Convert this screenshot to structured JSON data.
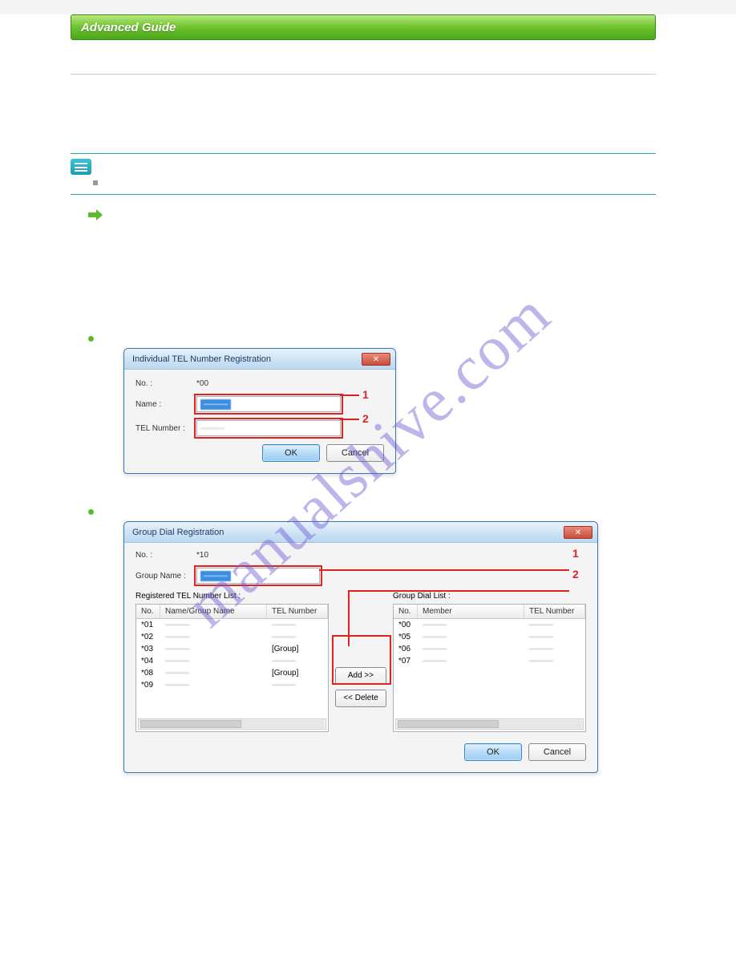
{
  "header": {
    "title": "Advanced Guide"
  },
  "dialog1": {
    "title": "Individual TEL Number Registration",
    "no_label": "No. :",
    "no_value": "*00",
    "name_label": "Name :",
    "name_value": "———",
    "tel_label": "TEL Number :",
    "tel_value": "———",
    "ok": "OK",
    "cancel": "Cancel",
    "callout1": "1",
    "callout2": "2"
  },
  "dialog2": {
    "title": "Group Dial Registration",
    "no_label": "No. :",
    "no_value": "*10",
    "group_name_label": "Group Name :",
    "group_name_value": "———",
    "reg_list_label": "Registered TEL Number List :",
    "group_list_label": "Group Dial List :",
    "col_no": "No.",
    "col_name": "Name/Group Name",
    "col_tel": "TEL Number",
    "col_member": "Member",
    "add": "Add >>",
    "delete": "<< Delete",
    "ok": "OK",
    "cancel": "Cancel",
    "callout1": "1",
    "callout2": "2",
    "reg_rows": [
      {
        "no": "*01",
        "name": "———",
        "tel": "———"
      },
      {
        "no": "*02",
        "name": "———",
        "tel": "———"
      },
      {
        "no": "*03",
        "name": "———",
        "tel": "[Group]"
      },
      {
        "no": "*04",
        "name": "———",
        "tel": "———"
      },
      {
        "no": "*08",
        "name": "———",
        "tel": "[Group]"
      },
      {
        "no": "*09",
        "name": "———",
        "tel": "———"
      }
    ],
    "group_rows": [
      {
        "no": "*00",
        "member": "———",
        "tel": "———"
      },
      {
        "no": "*05",
        "member": "———",
        "tel": "———"
      },
      {
        "no": "*06",
        "member": "———",
        "tel": "———"
      },
      {
        "no": "*07",
        "member": "———",
        "tel": "———"
      }
    ]
  },
  "watermark": "manualshive.com"
}
